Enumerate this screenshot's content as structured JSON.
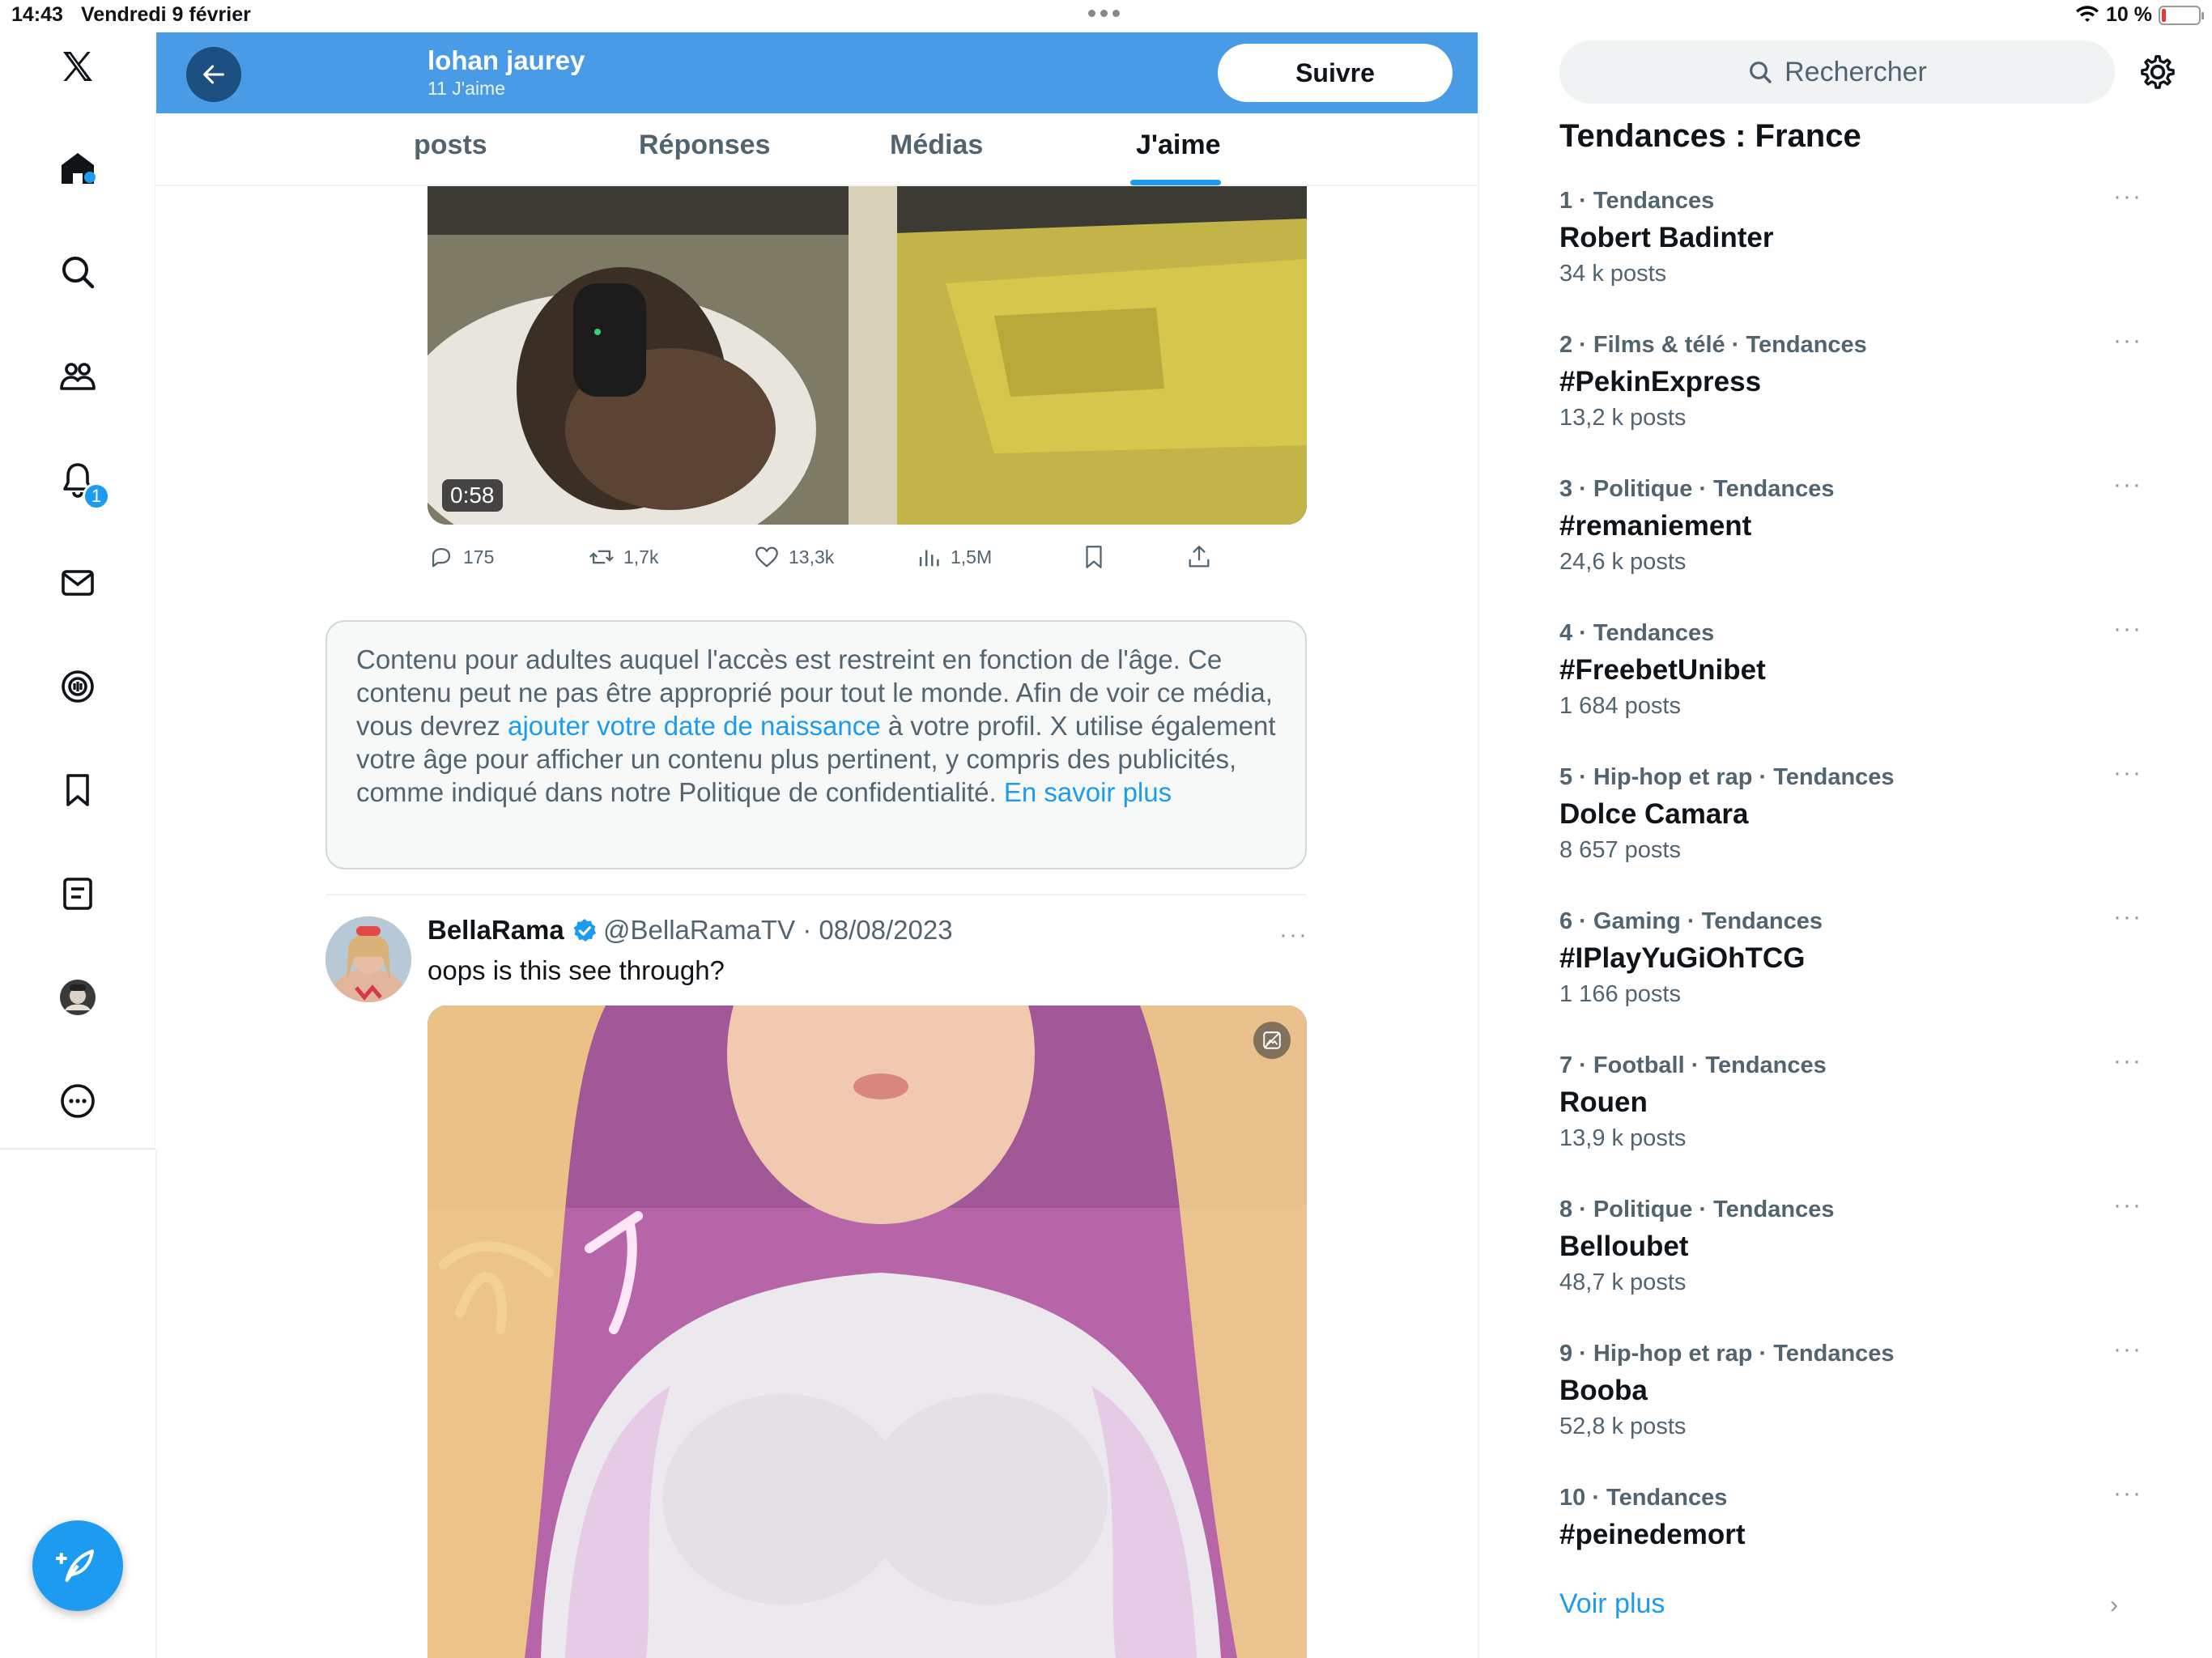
{
  "status_bar": {
    "time": "14:43",
    "date": "Vendredi 9 février",
    "battery_percent": "10 %"
  },
  "nav": {
    "icons": [
      "x-logo-icon",
      "home-icon",
      "search-icon",
      "communities-icon",
      "notifications-icon",
      "messages-icon",
      "spaces-icon",
      "bookmarks-icon",
      "lists-icon",
      "profile-avatar",
      "more-icon"
    ],
    "notifications_badge": "1"
  },
  "profile_header": {
    "name": "lohan jaurey",
    "subtitle": "11 J'aime",
    "follow_label": "Suivre"
  },
  "tabs": [
    {
      "label": "posts"
    },
    {
      "label": "Réponses"
    },
    {
      "label": "Médias"
    },
    {
      "label": "J'aime",
      "active": true
    }
  ],
  "tweet1": {
    "duration": "0:58",
    "replies": "175",
    "retweets": "1,7k",
    "likes": "13,3k",
    "views": "1,5M"
  },
  "notice": {
    "text_before": "Contenu pour adultes auquel l'accès est restreint en fonction de l'âge. Ce contenu peut ne pas être approprié pour tout le monde. Afin de voir ce média, vous devrez ",
    "link1": "ajouter votre date de naissance",
    "text_mid": " à votre profil. X utilise également votre âge pour afficher un contenu plus pertinent, y compris des publicités, comme indiqué dans notre Politique de confidentialité. ",
    "link2": "En savoir plus"
  },
  "tweet2": {
    "name": "BellaRama",
    "handle_date": "@BellaRamaTV · 08/08/2023",
    "text": "oops is this see through?",
    "more": "···"
  },
  "right": {
    "search_placeholder": "Rechercher",
    "trends_title": "Tendances : France",
    "trends": [
      {
        "meta": "1 · Tendances",
        "name": "Robert Badinter",
        "count": "34 k posts"
      },
      {
        "meta": "2 · Films & télé · Tendances",
        "name": "#PekinExpress",
        "count": "13,2 k posts"
      },
      {
        "meta": "3 · Politique · Tendances",
        "name": "#remaniement",
        "count": "24,6 k posts"
      },
      {
        "meta": "4 · Tendances",
        "name": "#FreebetUnibet",
        "count": "1 684 posts"
      },
      {
        "meta": "5 · Hip-hop et rap · Tendances",
        "name": "Dolce Camara",
        "count": "8 657 posts"
      },
      {
        "meta": "6 · Gaming · Tendances",
        "name": "#IPlayYuGiOhTCG",
        "count": "1 166 posts"
      },
      {
        "meta": "7 · Football · Tendances",
        "name": "Rouen",
        "count": "13,9 k posts"
      },
      {
        "meta": "8 · Politique · Tendances",
        "name": "Belloubet",
        "count": "48,7 k posts"
      },
      {
        "meta": "9 · Hip-hop et rap · Tendances",
        "name": "Booba",
        "count": "52,8 k posts"
      },
      {
        "meta": "10 · Tendances",
        "name": "#peinedemort",
        "count": ""
      }
    ],
    "show_more": "Voir plus"
  },
  "colors": {
    "accent": "#1d9bf0",
    "header_bg": "#4a9be6",
    "text": "#0f1419",
    "muted": "#536471"
  }
}
